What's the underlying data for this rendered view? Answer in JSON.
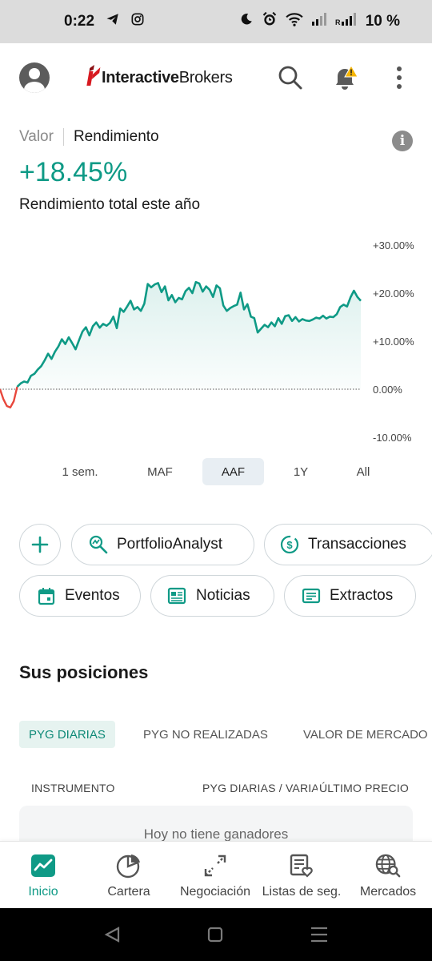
{
  "status_bar": {
    "time": "0:22",
    "battery": "10 %",
    "icons": [
      "telegram-icon",
      "instagram-icon",
      "moon-icon",
      "alarm-icon",
      "wifi-icon",
      "signal-icon",
      "signal-icon-2"
    ]
  },
  "header": {
    "logo_bold": "Interactive",
    "logo_regular": "Brokers",
    "icons": [
      "avatar-icon",
      "search-icon",
      "bell-alert-icon",
      "more-vert-icon"
    ]
  },
  "performance": {
    "tab_value": "Valor",
    "tab_return": "Rendimiento",
    "info_glyph": "i",
    "return_value": "+18.45%",
    "return_label": "Rendimiento total este año"
  },
  "chart_data": {
    "type": "area",
    "y_ticks": [
      "+30.00%",
      "+20.00%",
      "+10.00%",
      "0.00%",
      "-10.00%"
    ],
    "ylim": [
      -10,
      30
    ],
    "y_unit": "%",
    "baseline": 0,
    "colors": {
      "positive": "#0f9a86",
      "negative": "#e8473c"
    },
    "values": [
      0.0,
      -2.1,
      -3.5,
      -3.8,
      -2.5,
      0.5,
      1.2,
      1.6,
      1.4,
      2.8,
      3.2,
      4.1,
      4.8,
      6.0,
      7.4,
      6.3,
      7.8,
      8.9,
      10.4,
      9.4,
      10.8,
      9.6,
      8.3,
      10.2,
      12.0,
      12.9,
      11.2,
      13.1,
      13.9,
      12.8,
      13.6,
      13.2,
      13.8,
      15.1,
      12.7,
      16.8,
      16.1,
      17.2,
      18.4,
      16.6,
      17.1,
      16.3,
      17.8,
      21.9,
      21.2,
      21.8,
      22.1,
      20.2,
      21.4,
      18.5,
      19.6,
      18.1,
      19.0,
      18.7,
      20.4,
      21.1,
      20.0,
      22.3,
      22.0,
      20.3,
      21.4,
      20.7,
      19.2,
      21.6,
      21.0,
      17.4,
      16.3,
      16.9,
      17.3,
      17.6,
      20.1,
      16.6,
      17.7,
      15.1,
      14.8,
      11.8,
      12.6,
      13.4,
      12.9,
      13.9,
      13.1,
      14.8,
      13.6,
      15.2,
      15.4,
      14.2,
      15.0,
      14.1,
      14.6,
      14.3,
      14.2,
      14.5,
      14.9,
      14.7,
      15.3,
      14.7,
      15.1,
      15.0,
      15.6,
      17.1,
      17.6,
      17.2,
      19.1,
      20.5,
      19.2,
      18.4
    ]
  },
  "range_tabs": [
    "1 sem.",
    "MAF",
    "AAF",
    "1Y",
    "All"
  ],
  "range_active": "AAF",
  "quick_actions": {
    "portfolio_analyst": "PortfolioAnalyst",
    "transactions": "Transacciones",
    "events": "Eventos",
    "news": "Noticias",
    "statements": "Extractos"
  },
  "positions": {
    "title": "Sus posiciones",
    "tabs": [
      "PYG DIARIAS",
      "PYG NO REALIZADAS",
      "VALOR DE MERCADO"
    ],
    "active_tab": "PYG DIARIAS",
    "columns": [
      "INSTRUMENTO",
      "PYG DIARIAS / VARIACIÓN",
      "ÚLTIMO PRECIO"
    ],
    "empty_message": "Hoy no tiene ganadores"
  },
  "bottom_nav": {
    "items": [
      "Inicio",
      "Cartera",
      "Negociación",
      "Listas de seg.",
      "Mercados"
    ],
    "active": "Inicio"
  }
}
